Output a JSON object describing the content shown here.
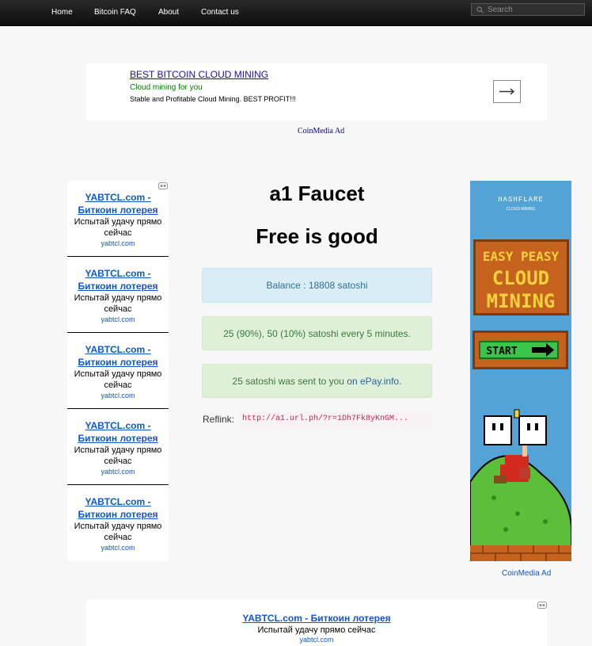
{
  "nav": {
    "items": [
      {
        "label": "Home"
      },
      {
        "label": "Bitcoin FAQ"
      },
      {
        "label": "About"
      },
      {
        "label": "Contact us"
      }
    ],
    "search_placeholder": "Search"
  },
  "top_ad": {
    "title": "BEST BITCOIN CLOUD MINING",
    "subtitle": "Cloud mining for you",
    "description": "Stable and Profitable Cloud Mining. BEST PROFIT!!!",
    "network_label": "CoinMedia Ad"
  },
  "left_ads": [
    {
      "title": "YABTCL.com - Биткоин лотерея",
      "desc": "Испытай удачу прямо сейчас",
      "url": "yabtcl.com"
    },
    {
      "title": "YABTCL.com - Биткоин лотерея",
      "desc": "Испытай удачу прямо сейчас",
      "url": "yabtcl.com"
    },
    {
      "title": "YABTCL.com - Биткоин лотерея",
      "desc": "Испытай удачу прямо сейчас",
      "url": "yabtcl.com"
    },
    {
      "title": "YABTCL.com - Биткоин лотерея",
      "desc": "Испытай удачу прямо сейчас",
      "url": "yabtcl.com"
    },
    {
      "title": "YABTCL.com - Биткоин лотерея",
      "desc": "Испытай удачу прямо сейчас",
      "url": "yabtcl.com"
    }
  ],
  "main": {
    "title": "a1 Faucet",
    "subtitle": "Free is good",
    "balance": "Balance : 18808 satoshi",
    "reward_info": "25 (90%), 50 (10%) satoshi every 5 minutes.",
    "sent_text": "25 satoshi was sent to you ",
    "sent_link": "on ePay.info.",
    "reflink_label": "Reflink:",
    "reflink_value": "http://a1.url.ph/?r=1Dh7Fk8yKnGM..."
  },
  "right_banner": {
    "brand": "HASHFLARE",
    "brand_sub": "CLOUD MINING",
    "line1": "EASY PEASY",
    "line2": "CLOUD",
    "line3": "MINING",
    "button": "START",
    "network_label": "CoinMedia Ad"
  },
  "bottom_ad": {
    "title": "YABTCL.com - Биткоин лотерея",
    "desc": "Испытай удачу прямо сейчас",
    "url": "yabtcl.com"
  },
  "colors": {
    "info_bg": "#d9edf7",
    "success_bg": "#dff0d8",
    "banner_sky": "#54a3d6",
    "link": "#1155cc"
  }
}
